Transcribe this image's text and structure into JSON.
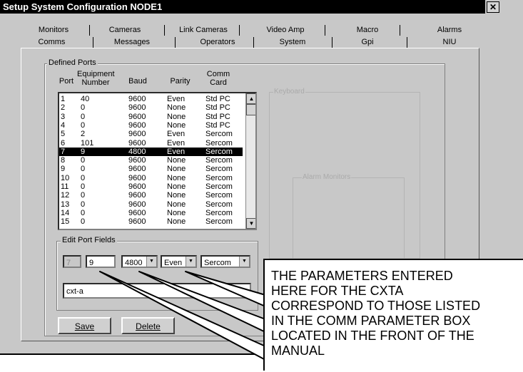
{
  "window": {
    "title": "Setup System Configuration  NODE1",
    "close_glyph": "✕"
  },
  "tabs": {
    "row1": [
      "Monitors",
      "Cameras",
      "Link Cameras",
      "Video Amp",
      "Macro",
      "Alarms"
    ],
    "row2": [
      "Comms",
      "Messages",
      "Operators",
      "System",
      "Gpi",
      "NIU"
    ],
    "active": "Comms"
  },
  "defined_ports": {
    "label": "Defined Ports",
    "headers": {
      "port": "Port",
      "equipment": "Equipment Number",
      "baud": "Baud",
      "parity": "Parity",
      "comm_card": "Comm Card"
    },
    "rows": [
      [
        "1",
        "40",
        "9600",
        "Even",
        "Std PC"
      ],
      [
        "2",
        "0",
        "9600",
        "None",
        "Std PC"
      ],
      [
        "3",
        "0",
        "9600",
        "None",
        "Std PC"
      ],
      [
        "4",
        "0",
        "9600",
        "None",
        "Std PC"
      ],
      [
        "5",
        "2",
        "9600",
        "Even",
        "Sercom"
      ],
      [
        "6",
        "101",
        "9600",
        "Even",
        "Sercom"
      ],
      [
        "7",
        "9",
        "4800",
        "Even",
        "Sercom"
      ],
      [
        "8",
        "0",
        "9600",
        "None",
        "Sercom"
      ],
      [
        "9",
        "0",
        "9600",
        "None",
        "Sercom"
      ],
      [
        "10",
        "0",
        "9600",
        "None",
        "Sercom"
      ],
      [
        "11",
        "0",
        "9600",
        "None",
        "Sercom"
      ],
      [
        "12",
        "0",
        "9600",
        "None",
        "Sercom"
      ],
      [
        "13",
        "0",
        "9600",
        "None",
        "Sercom"
      ],
      [
        "14",
        "0",
        "9600",
        "None",
        "Sercom"
      ],
      [
        "15",
        "0",
        "9600",
        "None",
        "Sercom"
      ]
    ],
    "selected_index": 6
  },
  "edit_port": {
    "label": "Edit Port Fields",
    "port": "7",
    "equipment": "9",
    "baud": "4800",
    "parity": "Even",
    "comm_card": "Sercom",
    "name": "cxt-a"
  },
  "buttons": {
    "save": "Save",
    "delete": "Delete"
  },
  "keyboard_label": "Keyboard",
  "alarm_monitors_label": "Alarm Monitors",
  "annotation": "THE PARAMETERS ENTERED\nHERE FOR THE CXTA\nCORRESPOND TO THOSE LISTED\nIN THE COMM PARAMETER BOX\nLOCATED IN THE FRONT OF THE\nMANUAL"
}
